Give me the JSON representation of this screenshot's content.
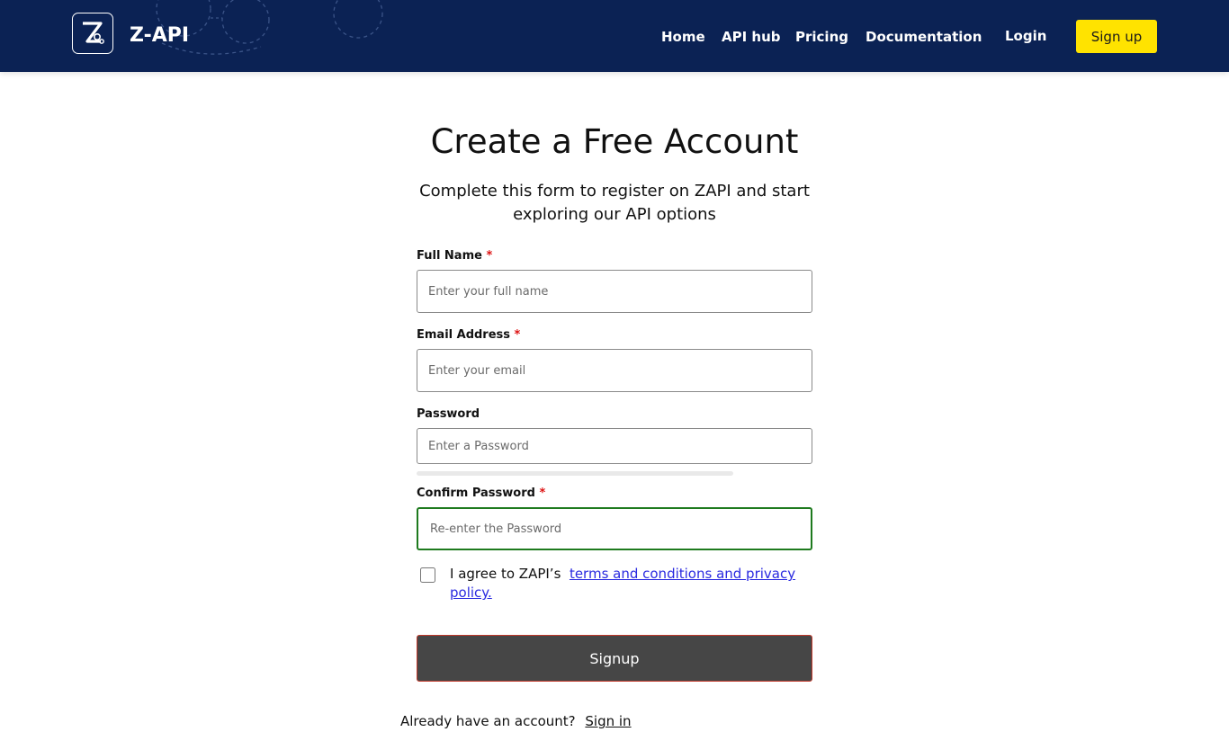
{
  "header": {
    "brand": "Z-API",
    "logo_icon": "z-api-logo-icon",
    "nav": [
      {
        "label": "Home"
      },
      {
        "label": "API hub"
      },
      {
        "label": "Pricing"
      },
      {
        "label": "Documentation"
      },
      {
        "label": "Login"
      }
    ],
    "signup_label": "Sign up",
    "colors": {
      "background": "#0b2254",
      "signup_button": "#ffe300"
    }
  },
  "form": {
    "title": "Create a Free Account",
    "subtitle": "Complete this form to register on ZAPI and start exploring our API options",
    "required_marker": "*",
    "fields": {
      "full_name": {
        "label": "Full Name",
        "placeholder": "Enter your full name",
        "value": ""
      },
      "email": {
        "label": "Email Address",
        "placeholder": "Enter your email",
        "value": ""
      },
      "password": {
        "label": "Password",
        "placeholder": "Enter a Password",
        "value": ""
      },
      "confirm_password": {
        "label": "Confirm Password",
        "placeholder": "Re-enter the Password",
        "value": ""
      }
    },
    "password_strength": 0,
    "agree_text": "I agree to ZAPI’s",
    "terms_link": "terms and conditions and privacy policy.",
    "agree_checked": false,
    "submit_label": "Signup",
    "signin_prompt": "Already have an account?",
    "signin_link": "Sign in",
    "colors": {
      "submit_button": "#464646",
      "focused_border": "#1e7a1e",
      "link": "#2a2ae0",
      "required": "#dd1111"
    }
  }
}
